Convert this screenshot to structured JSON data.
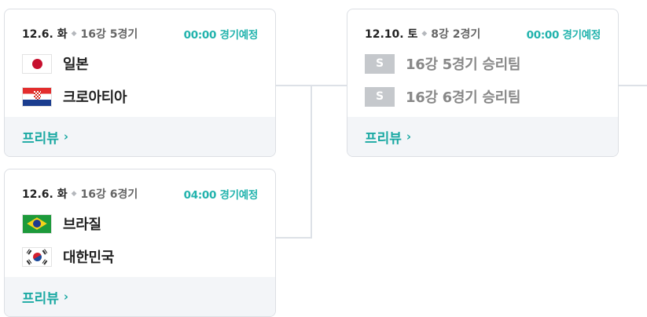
{
  "matches": [
    {
      "date": "12.6. 화",
      "round": "16강 5경기",
      "status": "00:00 경기예정",
      "home": {
        "name": "일본",
        "flag": "flag-japan-icon"
      },
      "away": {
        "name": "크로아티아",
        "flag": "flag-croatia-icon"
      },
      "preview_label": "프리뷰"
    },
    {
      "date": "12.6. 화",
      "round": "16강 6경기",
      "status": "04:00 경기예정",
      "home": {
        "name": "브라질",
        "flag": "flag-brazil-icon"
      },
      "away": {
        "name": "대한민국",
        "flag": "flag-korea-icon"
      },
      "preview_label": "프리뷰"
    },
    {
      "date": "12.10. 토",
      "round": "8강 2경기",
      "status": "00:00 경기예정",
      "home": {
        "name": "16강 5경기 승리팀",
        "placeholder": "S"
      },
      "away": {
        "name": "16강 6경기 승리팀",
        "placeholder": "S"
      },
      "preview_label": "프리뷰"
    }
  ],
  "colors": {
    "accent": "#22b3ad",
    "footer_bg": "#f3f5f8",
    "connector": "#dde1e7",
    "placeholder_bg": "#c5c8cc"
  },
  "icons": {
    "separator": "diamond-dot-icon",
    "chevron": "chevron-right-icon"
  }
}
